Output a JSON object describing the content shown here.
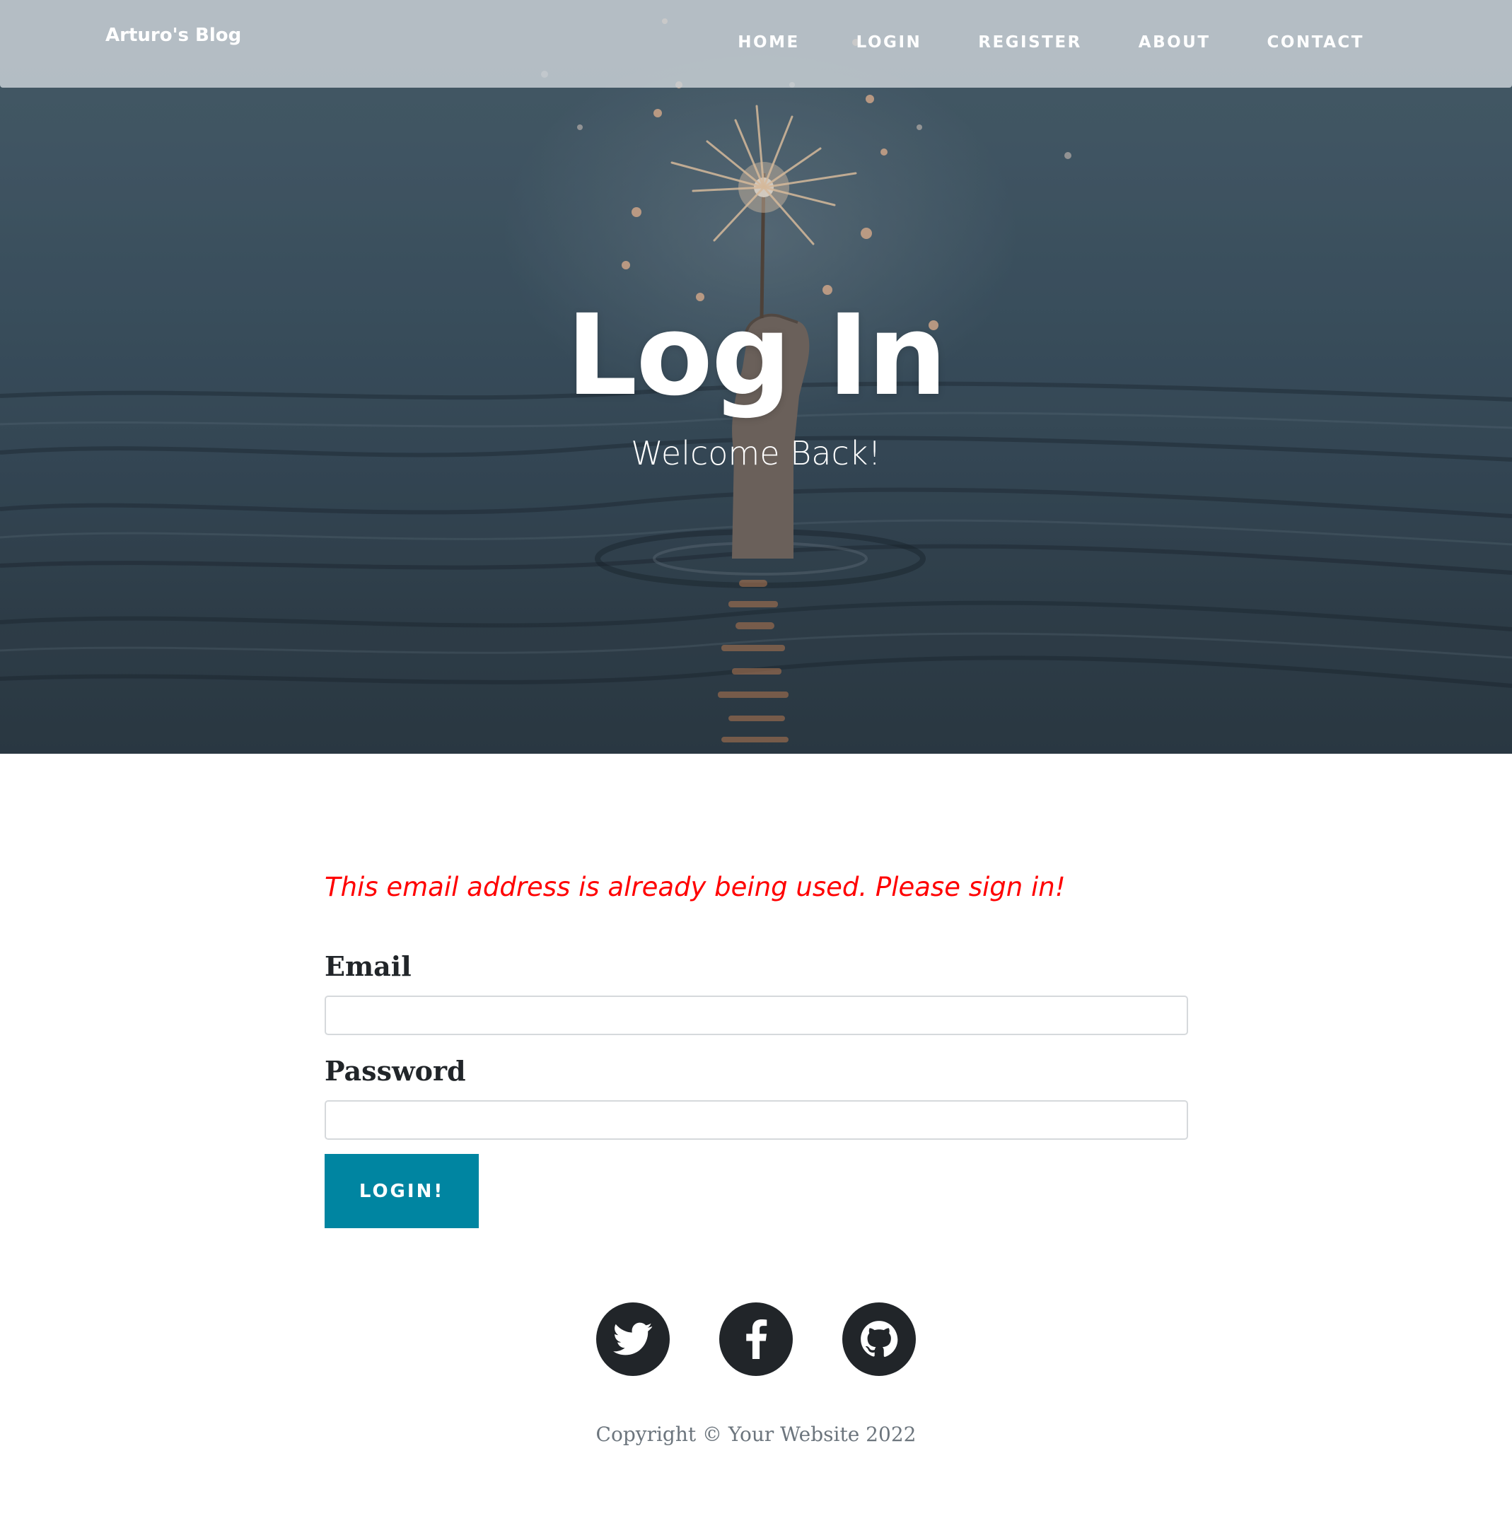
{
  "navbar": {
    "brand": "Arturo's Blog",
    "links": [
      {
        "label": "HOME"
      },
      {
        "label": "LOGIN"
      },
      {
        "label": "REGISTER"
      },
      {
        "label": "ABOUT"
      },
      {
        "label": "CONTACT"
      }
    ]
  },
  "hero": {
    "title": "Log In",
    "subtitle": "Welcome Back!"
  },
  "main": {
    "flash_message": "This email address is already being used. Please sign in!",
    "email_label": "Email",
    "email_value": "",
    "password_label": "Password",
    "password_value": "",
    "submit_label": "LOGIN!"
  },
  "footer": {
    "social": [
      {
        "icon": "twitter-icon"
      },
      {
        "icon": "facebook-icon"
      },
      {
        "icon": "github-icon"
      }
    ],
    "copyright": "Copyright © Your Website 2022"
  },
  "colors": {
    "accent": "#0085a1",
    "flash": "#ff0000",
    "text": "#212529",
    "muted": "#6c757d"
  }
}
